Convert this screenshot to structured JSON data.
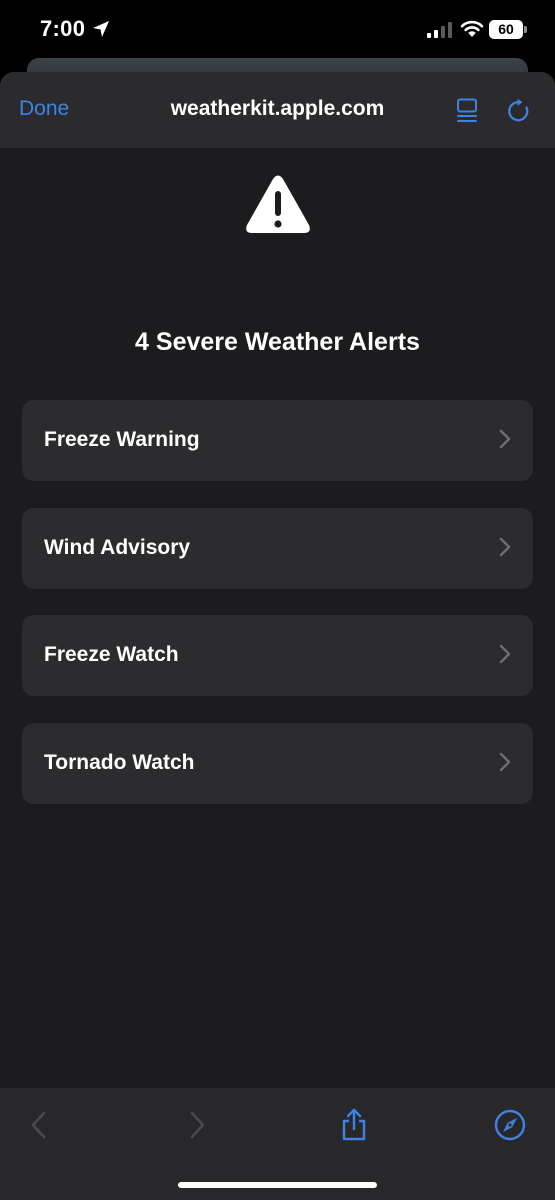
{
  "status_bar": {
    "time": "7:00",
    "battery_level": "60",
    "icons": [
      "location-arrow-icon",
      "cellular-signal-icon",
      "wifi-icon",
      "battery-icon"
    ]
  },
  "browser": {
    "done_label": "Done",
    "url": "weatherkit.apple.com",
    "accent_color": "#3d83e6",
    "icons": [
      "reader-mode-icon",
      "reload-icon"
    ]
  },
  "page": {
    "heading": "4 Severe Weather Alerts",
    "heading_icon": "warning-triangle-icon",
    "alerts": [
      {
        "label": "Freeze Warning"
      },
      {
        "label": "Wind Advisory"
      },
      {
        "label": "Freeze Watch"
      },
      {
        "label": "Tornado Watch"
      }
    ]
  },
  "toolbar": {
    "icons": [
      "back-chevron-icon",
      "forward-chevron-icon",
      "share-icon",
      "compass-icon"
    ]
  }
}
